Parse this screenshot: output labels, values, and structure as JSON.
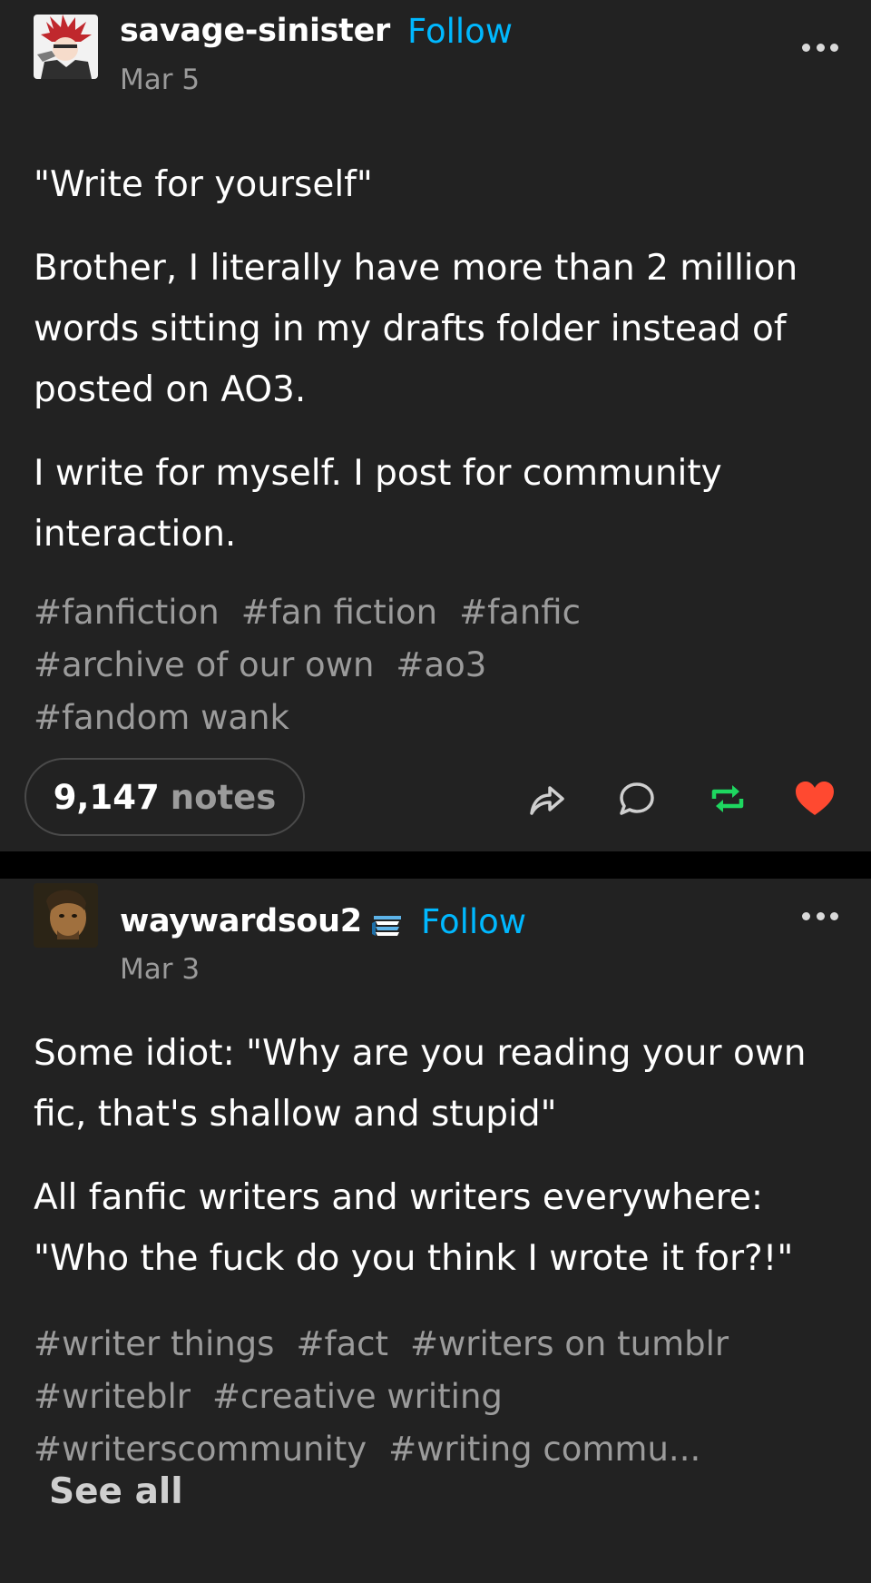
{
  "posts": [
    {
      "username": "savage-sinister",
      "follow_label": "Follow",
      "date": "Mar 5",
      "paragraphs": [
        "\"Write for yourself\"",
        "Brother, I literally have more than 2 million words sitting in my drafts folder instead of posted on AO3.",
        "I write for myself. I post for community interaction."
      ],
      "tags": [
        "#fanfiction",
        "#fan fiction",
        "#fanfic",
        "#archive of our own",
        "#ao3",
        "#fandom wank"
      ],
      "notes_count": "9,147",
      "notes_label": "notes",
      "colors": {
        "reblog_icon": "#1ed760",
        "like_icon": "#ff4930"
      }
    },
    {
      "username": "waywardsou2",
      "follow_label": "Follow",
      "date": "Mar 3",
      "paragraphs": [
        "Some idiot: \"Why are you reading your own fic, that's shallow and stupid\"",
        "All fanfic writers and writers everywhere: \"Who the fuck do you think I wrote it for?!\""
      ],
      "tags": [
        "#writer things",
        "#fact",
        "#writers on tumblr",
        "#writeblr",
        "#creative writing",
        "#writerscommunity",
        "#writing commu..."
      ],
      "see_all_label": "See all"
    }
  ],
  "colors": {
    "background": "#000000",
    "card": "#222222",
    "follow": "#00b8ff",
    "secondary_text": "#9b9b9b"
  },
  "icons": [
    "more-icon",
    "share-icon",
    "reply-icon",
    "reblog-icon",
    "heart-icon",
    "badge-icon"
  ]
}
